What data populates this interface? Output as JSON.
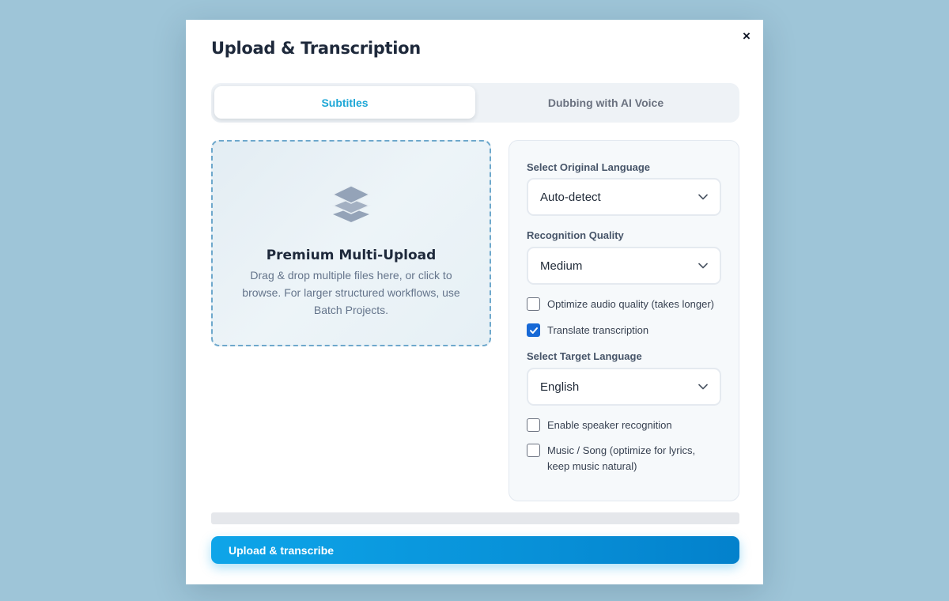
{
  "modal": {
    "title": "Upload & Transcription",
    "close_icon": "×"
  },
  "tabs": [
    {
      "label": "Subtitles",
      "active": true
    },
    {
      "label": "Dubbing with AI Voice",
      "active": false
    }
  ],
  "dropzone": {
    "icon": "layers-icon",
    "title": "Premium Multi-Upload",
    "description": "Drag & drop multiple files here, or click to browse. For larger structured workflows, use Batch Projects."
  },
  "settings": {
    "original_language": {
      "label": "Select Original Language",
      "value": "Auto-detect"
    },
    "recognition_quality": {
      "label": "Recognition Quality",
      "value": "Medium"
    },
    "optimize_audio": {
      "label": "Optimize audio quality (takes longer)",
      "checked": false
    },
    "translate": {
      "label": "Translate transcription",
      "checked": true
    },
    "target_language": {
      "label": "Select Target Language",
      "value": "English"
    },
    "speaker_recognition": {
      "label": "Enable speaker recognition",
      "checked": false
    },
    "music_song": {
      "label": "Music / Song (optimize for lyrics, keep music natural)",
      "checked": false
    }
  },
  "progress": {
    "value": 0
  },
  "actions": {
    "upload_label": "Upload & transcribe"
  },
  "colors": {
    "accent": "#1ea7d6",
    "button_start": "#0ea5e9",
    "button_end": "#0381cc",
    "checkbox_checked": "#1769d6",
    "background": "#9ec5d8"
  }
}
